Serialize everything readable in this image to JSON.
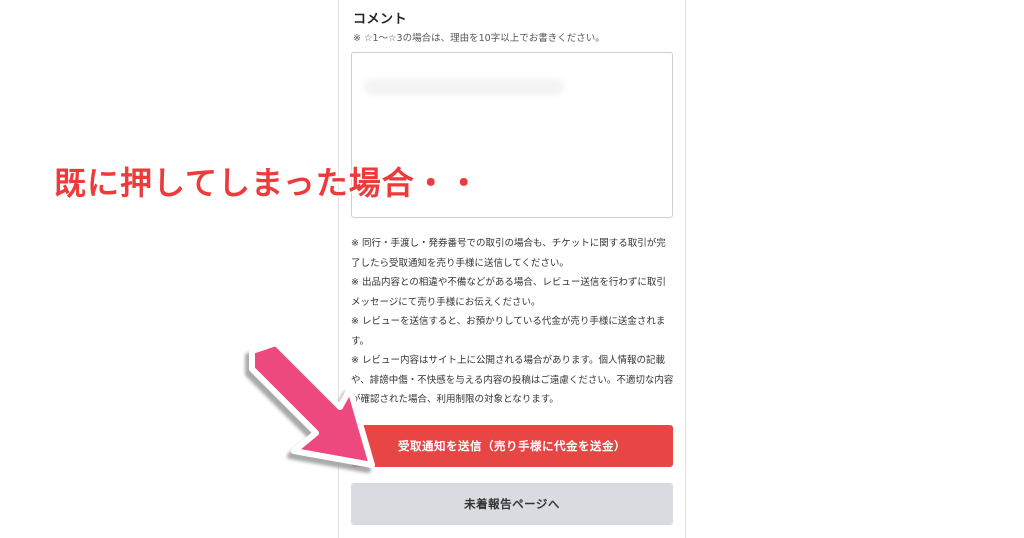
{
  "comment": {
    "title": "コメント",
    "note": "※ ☆1〜☆3の場合は、理由を10字以上でお書きください。"
  },
  "notes": [
    "※ 同行・手渡し・発券番号での取引の場合も、チケットに関する取引が完了したら受取通知を売り手様に送信してください。",
    "※ 出品内容との相違や不備などがある場合、レビュー送信を行わずに取引メッセージにて売り手様にお伝えください。",
    "※ レビューを送信すると、お預かりしている代金が売り手様に送金されます。",
    "※ レビュー内容はサイト上に公開される場合があります。個人情報の記載や、誹謗中傷・不快感を与える内容の投稿はご遠慮ください。不適切な内容が確認された場合、利用制限の対象となります。"
  ],
  "buttons": {
    "send_receipt": "受取通知を送信（売り手様に代金を送金）",
    "not_arrived": "未着報告ページへ"
  },
  "overlay": {
    "caption": "既に押してしまった場合・・"
  },
  "colors": {
    "primary_button": "#e84545",
    "secondary_button": "#d9dbe0",
    "caption_text": "#ee3a3a",
    "arrow": "#ee4a7f"
  },
  "icons": {
    "arrow": "pointing-arrow-icon"
  }
}
